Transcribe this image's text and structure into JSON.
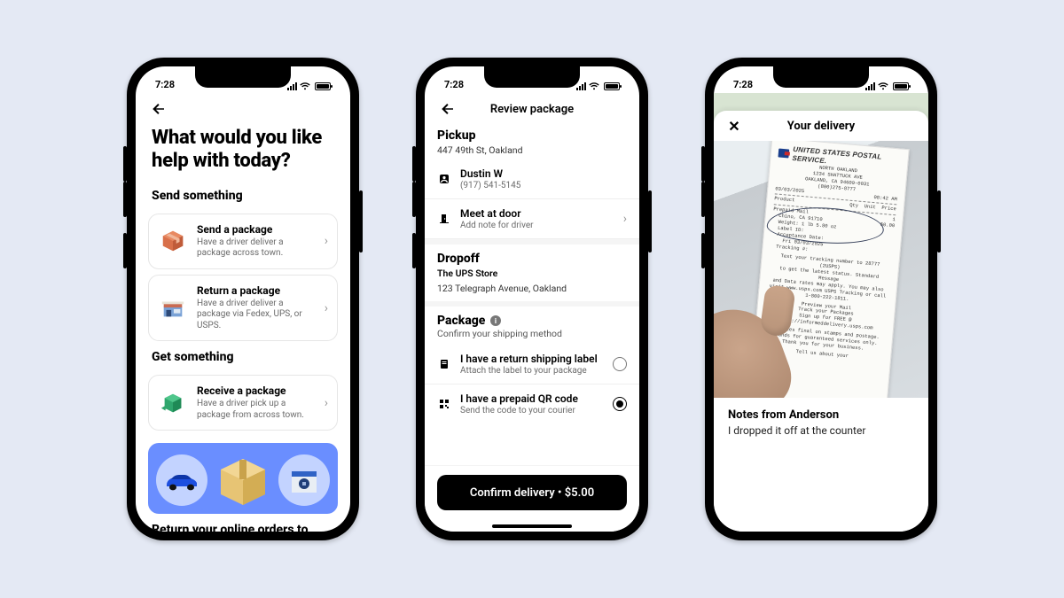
{
  "status": {
    "time": "7:28"
  },
  "screen1": {
    "heading": "What would you like help with today?",
    "sections": {
      "send": {
        "title": "Send something",
        "cards": [
          {
            "title": "Send a package",
            "sub": "Have a driver deliver a package across town."
          },
          {
            "title": "Return a package",
            "sub": "Have a driver deliver a package via Fedex, UPS, or USPS."
          }
        ]
      },
      "get": {
        "title": "Get something",
        "cards": [
          {
            "title": "Receive a package",
            "sub": "Have a driver pick up a package from across town."
          }
        ]
      }
    },
    "promo_line": "Return your online orders to"
  },
  "screen2": {
    "title": "Review package",
    "pickup": {
      "heading": "Pickup",
      "address": "447 49th St, Oakland",
      "contact": {
        "name": "Dustin W",
        "phone": "(917) 541-5145"
      },
      "meet": {
        "label": "Meet at door",
        "sub": "Add note for driver"
      }
    },
    "dropoff": {
      "heading": "Dropoff",
      "name": "The UPS Store",
      "address": "123 Telegraph Avenue, Oakland"
    },
    "package": {
      "heading": "Package",
      "sub": "Confirm your shipping method",
      "options": [
        {
          "label": "I have a return shipping label",
          "sub": "Attach the label to your package",
          "selected": false
        },
        {
          "label": "I have a prepaid QR code",
          "sub": "Send the code to your courier",
          "selected": true
        }
      ]
    },
    "cta": "Confirm delivery • $5.00"
  },
  "screen3": {
    "title": "Your delivery",
    "receipt": {
      "brand": "UNITED STATES POSTAL SERVICE.",
      "store1": "NORTH OAKLAND",
      "store2": "1234 SHATTUCK AVE",
      "store3": "OAKLAND, CA 94609-0031",
      "store4": "(800)275-8777",
      "date": "03/03/2025",
      "time": "08:42 AM",
      "hdr_product": "Product",
      "hdr_qty": "Qty",
      "hdr_unit": "Unit",
      "hdr_price": "Price",
      "line_item": "Prepaid Mail",
      "line_qty": "1",
      "dest": "Chino, CA 91710",
      "weight": "Weight: 1 lb 5.80 oz",
      "label": "Label ID:",
      "accept": "Acceptance Date:",
      "accept_date": "Fri 03/03/2025",
      "tracking": "Tracking #:",
      "price": "$0.00",
      "msg1": "Text your tracking number to 28777 (2USPS)",
      "msg2": "to get the latest status. Standard Message",
      "msg3": "and Data rates may apply. You may also",
      "msg4": "visit www.usps.com USPS Tracking or call",
      "msg5": "1-800-222-1811.",
      "msg6": "Preview your Mail",
      "msg7": "Track your Packages",
      "msg8": "Sign up for FREE @",
      "msg_url": "https://informeddelivery.usps.com",
      "msg9": "All sales final on stamps and postage.",
      "msg10": "Refunds for guaranteed services only.",
      "msg11": "Thank you for your business.",
      "msg12": "Tell us about your"
    },
    "notes": {
      "heading": "Notes from Anderson",
      "body": "I dropped it off at the counter"
    }
  }
}
